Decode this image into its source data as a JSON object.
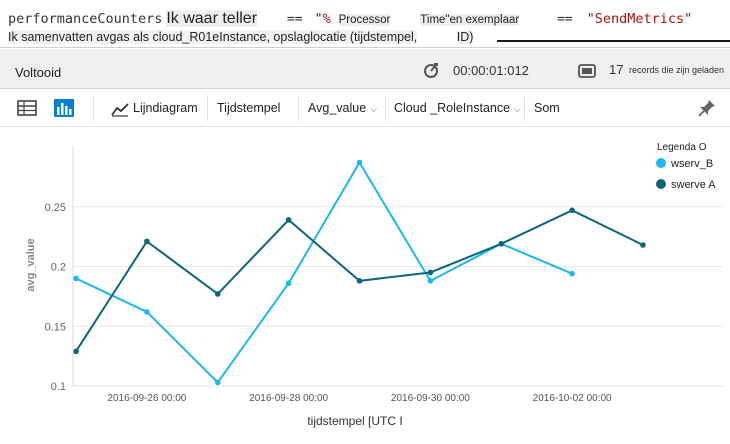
{
  "query": {
    "line1": {
      "table": "performanceCounters",
      "where_text": "Ik waar teller",
      "op1": "==",
      "str1_prefix": "\"%",
      "counter_word": "Processor",
      "counter_rest": "Time\"en exemplaar",
      "op2": "==",
      "str2": "\"SendMetrics\""
    },
    "line2": {
      "summarize_text": "Ik samenvatten avgas als cloud_R01eInstance, opslaglocatie (tijdstempel,",
      "id_text": "ID)"
    }
  },
  "status": {
    "state": "Voltooid",
    "elapsed": "00:00:01:012",
    "records_count": "17",
    "records_label": "records die zijn geladen"
  },
  "toolbar": {
    "table_icon": "table-icon",
    "chart_icon": "bar-chart-icon",
    "line_chart_label": "Lijndiagram",
    "xaxis_label": "Tijdstempel",
    "yaxis_dropdown": "Avg_value",
    "split_dropdown": "Cloud _RoleInstance",
    "agg_label": "Som",
    "pin_icon": "pin-icon"
  },
  "colors": {
    "wserv_b": "#1cb8ec",
    "swerve_a": "#0d6579",
    "accent": "#0b7fd1"
  },
  "chart_data": {
    "type": "line",
    "xlabel": "tijdstempel [UTC I",
    "ylabel": "avg_value",
    "legend_title": "Legenda O",
    "legend_position": "top-right",
    "x": [
      "2016-09-25 00:00",
      "2016-09-26 00:00",
      "2016-09-27 00:00",
      "2016-09-28 00:00",
      "2016-09-29 00:00",
      "2016-09-30 00:00",
      "2016-10-01 00:00",
      "2016-10-02 00:00",
      "2016-10-03 00:00"
    ],
    "x_tick_labels": [
      "2016-09-26 00:00",
      "2016-09-28 00:00",
      "2016-09-30 00:00",
      "2016-10-02 00:00"
    ],
    "y_ticks": [
      0.1,
      0.15,
      0.2,
      0.25
    ],
    "ylim": [
      0.1,
      0.3
    ],
    "grid": "horizontal",
    "series": [
      {
        "name": "wserv_B",
        "color": "#1cb8ec",
        "values": [
          0.19,
          0.162,
          0.103,
          0.186,
          0.287,
          0.188,
          0.219,
          0.194,
          null
        ]
      },
      {
        "name": "swerve A",
        "color": "#0d6579",
        "values": [
          0.129,
          0.221,
          0.177,
          0.239,
          0.188,
          0.195,
          0.219,
          0.247,
          0.218
        ]
      }
    ]
  }
}
